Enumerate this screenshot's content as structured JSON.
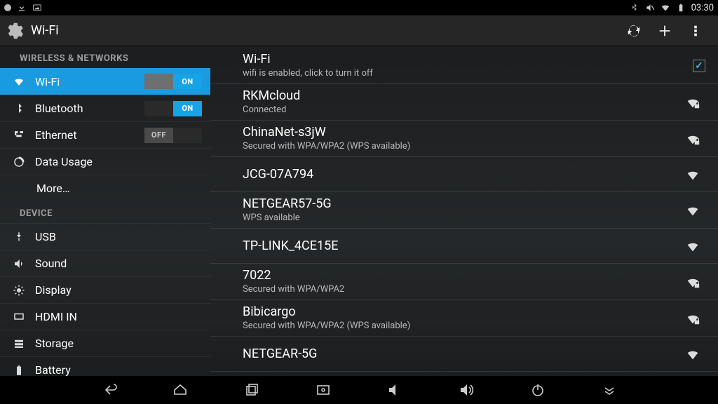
{
  "statusbar": {
    "time": "03:30"
  },
  "actionbar": {
    "title": "Wi-Fi"
  },
  "sidebar": {
    "section1": "WIRELESS & NETWORKS",
    "section2": "DEVICE",
    "wifi": {
      "label": "Wi-Fi",
      "toggle_on": "ON",
      "state": "on"
    },
    "bluetooth": {
      "label": "Bluetooth",
      "toggle_on": "ON",
      "state": "on"
    },
    "ethernet": {
      "label": "Ethernet",
      "toggle_off": "OFF",
      "state": "off"
    },
    "data": {
      "label": "Data Usage"
    },
    "more": {
      "label": "More…"
    },
    "usb": {
      "label": "USB"
    },
    "sound": {
      "label": "Sound"
    },
    "display": {
      "label": "Display"
    },
    "hdmi": {
      "label": "HDMI IN"
    },
    "storage": {
      "label": "Storage"
    },
    "battery": {
      "label": "Battery"
    }
  },
  "wifi_toggle": {
    "title": "Wi-Fi",
    "sub": "wifi is enabled, click to turn it off",
    "checked": true
  },
  "networks": [
    {
      "ssid": "RKMcloud",
      "sub": "Connected",
      "secure": true
    },
    {
      "ssid": "ChinaNet-s3jW",
      "sub": "Secured with WPA/WPA2 (WPS available)",
      "secure": true
    },
    {
      "ssid": "JCG-07A794",
      "sub": "",
      "secure": false
    },
    {
      "ssid": "NETGEAR57-5G",
      "sub": "WPS available",
      "secure": false
    },
    {
      "ssid": "TP-LINK_4CE15E",
      "sub": "",
      "secure": false
    },
    {
      "ssid": "7022",
      "sub": "Secured with WPA/WPA2",
      "secure": true
    },
    {
      "ssid": "Bibicargo",
      "sub": "Secured with WPA/WPA2 (WPS available)",
      "secure": true
    },
    {
      "ssid": "NETGEAR-5G",
      "sub": "",
      "secure": false
    }
  ]
}
